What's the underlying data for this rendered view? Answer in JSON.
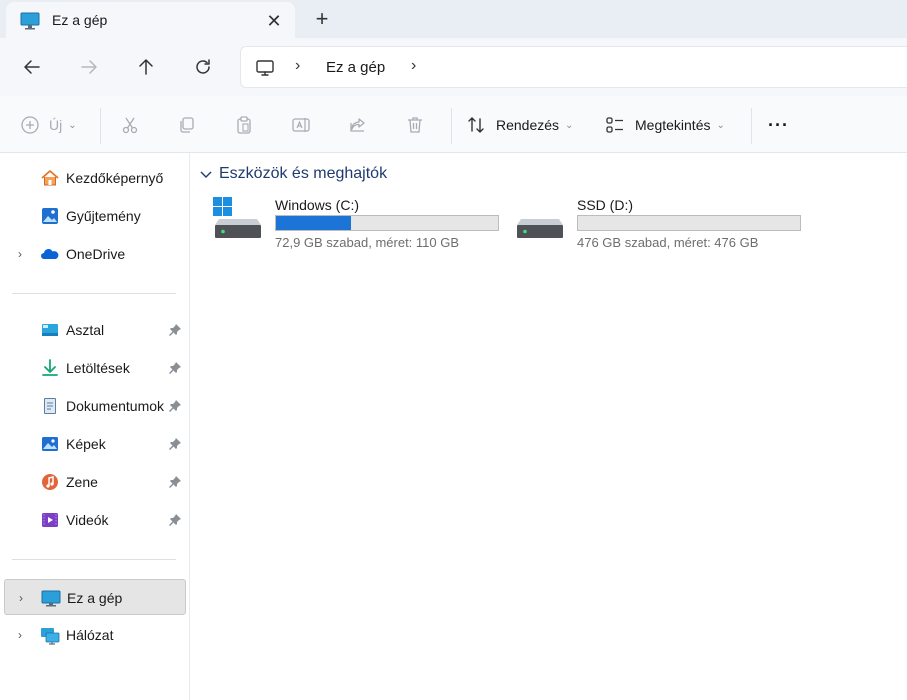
{
  "tab": {
    "title": "Ez a gép",
    "close": "✕",
    "add": "+"
  },
  "address": {
    "crumb": "Ez a gép",
    "sep": "›"
  },
  "toolbar": {
    "new_label": "Új",
    "sort_label": "Rendezés",
    "view_label": "Megtekintés",
    "more_label": "···"
  },
  "sidebar": {
    "items": [
      {
        "label": "Kezdőképernyő",
        "icon": "home-icon"
      },
      {
        "label": "Gyűjtemény",
        "icon": "gallery-icon"
      },
      {
        "label": "OneDrive",
        "icon": "onedrive-icon",
        "expandable": true
      },
      {
        "label": "Asztal",
        "icon": "desktop-icon",
        "pinned": true
      },
      {
        "label": "Letöltések",
        "icon": "download-icon",
        "pinned": true
      },
      {
        "label": "Dokumentumok",
        "icon": "documents-icon",
        "pinned": true
      },
      {
        "label": "Képek",
        "icon": "pictures-icon",
        "pinned": true
      },
      {
        "label": "Zene",
        "icon": "music-icon",
        "pinned": true
      },
      {
        "label": "Videók",
        "icon": "videos-icon",
        "pinned": true
      },
      {
        "label": "Ez a gép",
        "icon": "this-pc-icon",
        "expandable": true,
        "selected": true
      },
      {
        "label": "Hálózat",
        "icon": "network-icon",
        "expandable": true
      }
    ]
  },
  "main": {
    "group_title": "Eszközök és meghajtók",
    "drives": [
      {
        "name": "Windows (C:)",
        "info": "72,9 GB szabad, méret: 110 GB",
        "used_fraction": 0.337
      },
      {
        "name": "SSD (D:)",
        "info": "476 GB szabad, méret: 476 GB",
        "used_fraction": 0.0
      }
    ]
  },
  "colors": {
    "accent": "#1b74d6",
    "group_header": "#1f3a6e"
  }
}
